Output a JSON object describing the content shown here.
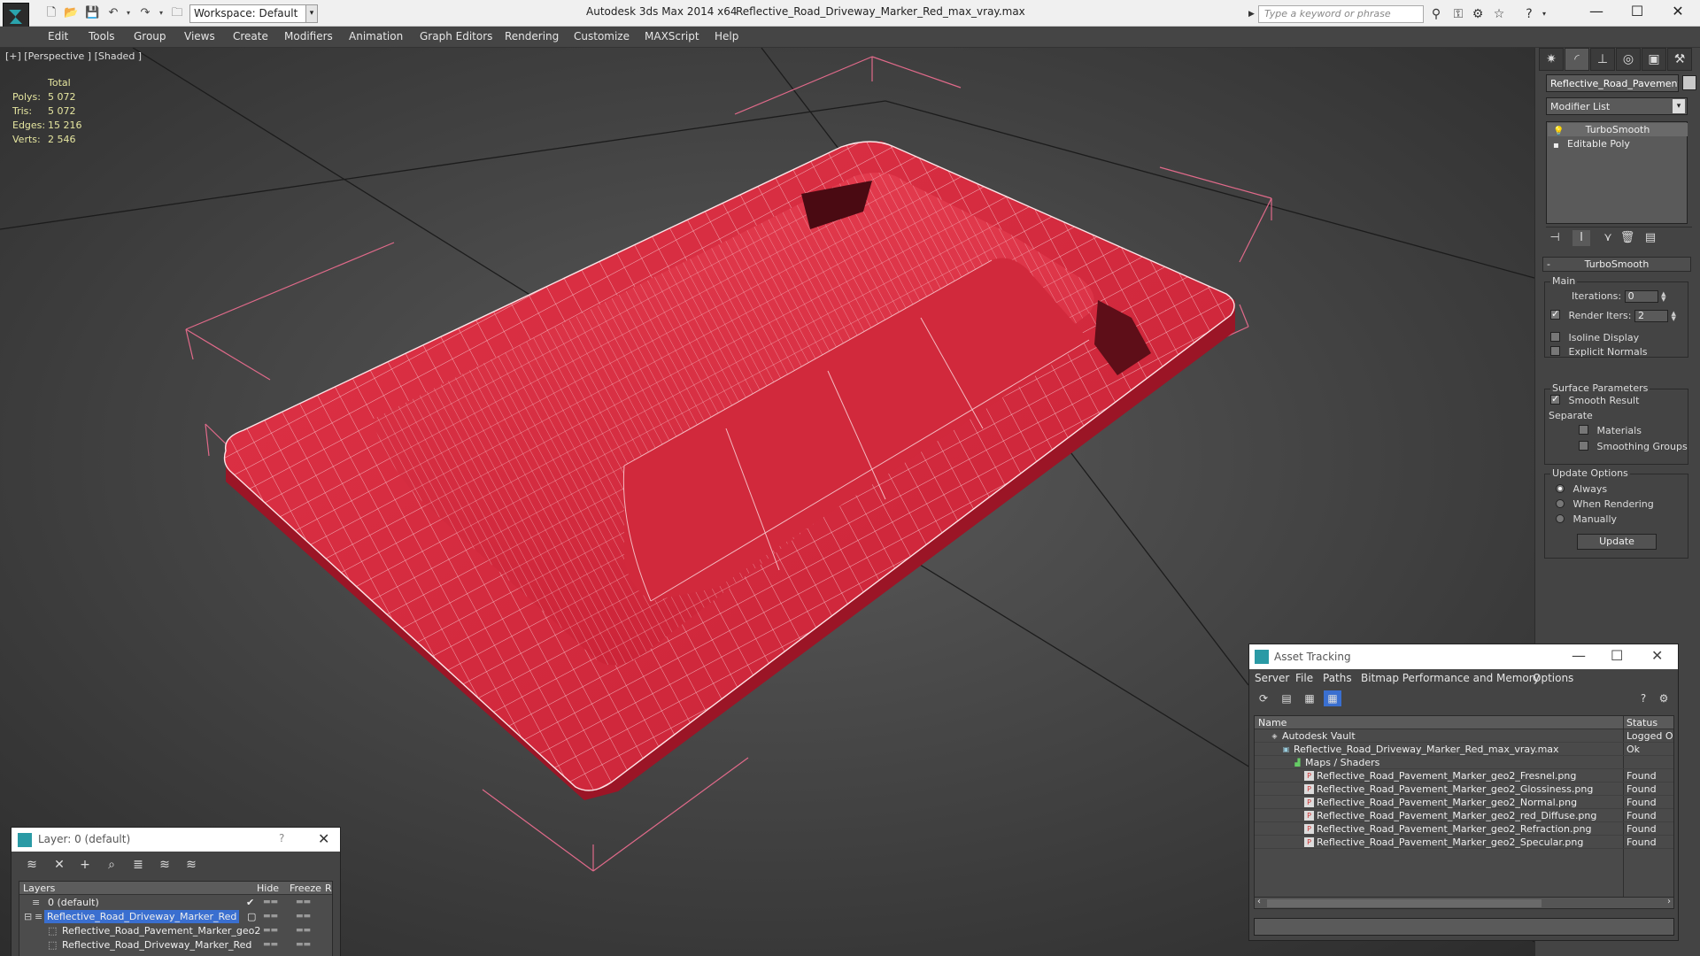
{
  "titlebar": {
    "workspace": "Workspace: Default",
    "app_title": "Autodesk 3ds Max  2014 x64",
    "file_title": "Reflective_Road_Driveway_Marker_Red_max_vray.max",
    "search_placeholder": "Type a keyword or phrase",
    "icons": [
      "new-icon",
      "open-icon",
      "save-icon",
      "undo-icon",
      "redo-icon",
      "project-icon",
      "binoculars-icon",
      "key-icon",
      "star-icon",
      "help-icon"
    ]
  },
  "menu": [
    "Edit",
    "Tools",
    "Group",
    "Views",
    "Create",
    "Modifiers",
    "Animation",
    "Graph Editors",
    "Rendering",
    "Customize",
    "MAXScript",
    "Help"
  ],
  "viewport": {
    "label": "[+] [Perspective ] [Shaded ]",
    "stats": {
      "header": "Total",
      "rows": [
        {
          "k": "Polys:",
          "v": "5 072"
        },
        {
          "k": "Tris:",
          "v": "5 072"
        },
        {
          "k": "Edges:",
          "v": "15 216"
        },
        {
          "k": "Verts:",
          "v": "2 546"
        }
      ]
    },
    "object_color": "#d32a3e"
  },
  "command_panel": {
    "object_name": "Reflective_Road_Pavement_I",
    "modifier_list": "Modifier List",
    "stack": [
      "TurboSmooth",
      "Editable Poly"
    ],
    "rollout": "TurboSmooth",
    "main": {
      "title": "Main",
      "iterations_label": "Iterations:",
      "iterations_value": "0",
      "render_iters_label": "Render Iters:",
      "render_iters_value": "2",
      "isoline": "Isoline Display",
      "explicit": "Explicit Normals"
    },
    "surface": {
      "title": "Surface Parameters",
      "smooth_result": "Smooth Result",
      "separate": "Separate",
      "materials": "Materials",
      "smoothing_groups": "Smoothing Groups"
    },
    "update": {
      "title": "Update Options",
      "always": "Always",
      "when_rendering": "When Rendering",
      "manually": "Manually",
      "button": "Update"
    }
  },
  "layer_dialog": {
    "title": "Layer: 0 (default)",
    "help": "?",
    "columns": {
      "layers": "Layers",
      "hide": "Hide",
      "freeze": "Freeze",
      "r": "R"
    },
    "rows": [
      {
        "name": "0 (default)"
      },
      {
        "name": "Reflective_Road_Driveway_Marker_Red"
      },
      {
        "name": "Reflective_Road_Pavement_Marker_geo2"
      },
      {
        "name": "Reflective_Road_Driveway_Marker_Red"
      }
    ]
  },
  "asset_dialog": {
    "title": "Asset Tracking",
    "menu": [
      "Server",
      "File",
      "Paths",
      "Bitmap Performance and Memory",
      "Options"
    ],
    "columns": {
      "name": "Name",
      "status": "Status"
    },
    "rows": [
      {
        "name": "Autodesk Vault",
        "status": "Logged O"
      },
      {
        "name": "Reflective_Road_Driveway_Marker_Red_max_vray.max",
        "status": "Ok"
      },
      {
        "name": "Maps / Shaders",
        "status": ""
      },
      {
        "name": "Reflective_Road_Pavement_Marker_geo2_Fresnel.png",
        "status": "Found"
      },
      {
        "name": "Reflective_Road_Pavement_Marker_geo2_Glossiness.png",
        "status": "Found"
      },
      {
        "name": "Reflective_Road_Pavement_Marker_geo2_Normal.png",
        "status": "Found"
      },
      {
        "name": "Reflective_Road_Pavement_Marker_geo2_red_Diffuse.png",
        "status": "Found"
      },
      {
        "name": "Reflective_Road_Pavement_Marker_geo2_Refraction.png",
        "status": "Found"
      },
      {
        "name": "Reflective_Road_Pavement_Marker_geo2_Specular.png",
        "status": "Found"
      }
    ]
  }
}
